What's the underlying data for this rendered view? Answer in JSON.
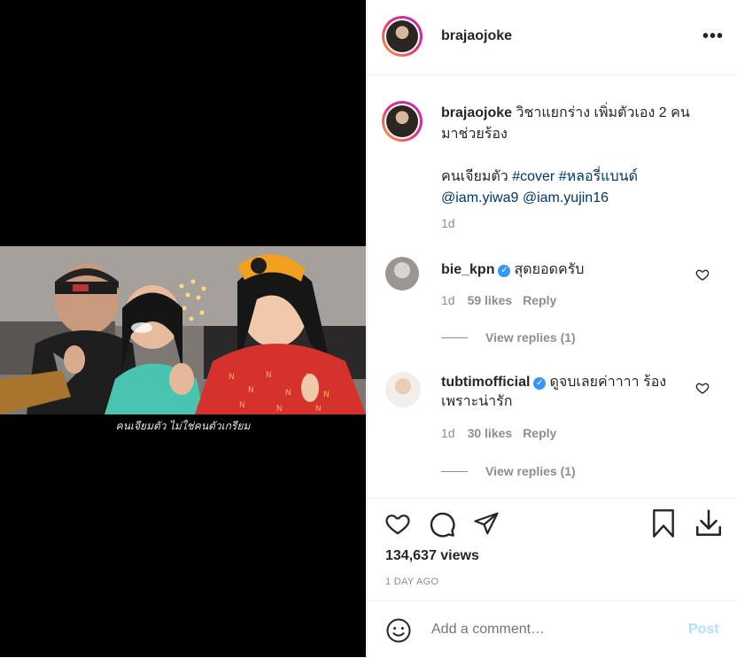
{
  "post_author": {
    "username": "brajaojoke"
  },
  "video": {
    "subtitle": "คนเจียมตัว ไม่ใช่คนตัวเกรียม"
  },
  "caption": {
    "username": "brajaojoke",
    "text_line1": "วิชาแยกร่าง เพิ่มตัวเอง 2 คน",
    "text_line2": "มาช่วยร้อง",
    "text_line3_plain": "คนเจียมตัว",
    "hashtag1": "#cover",
    "hashtag2": "#หลอรี่แบนด์",
    "mention1": "@iam.yiwa9",
    "mention2": "@iam.yujin16",
    "time": "1d"
  },
  "comments": [
    {
      "username": "bie_kpn",
      "verified": true,
      "text": "สุดยอดครับ",
      "time": "1d",
      "likes": "59 likes",
      "reply_label": "Reply",
      "view_replies": "View replies (1)"
    },
    {
      "username": "tubtimofficial",
      "verified": true,
      "text": "ดูจบเลยค่าาาา ร้อง",
      "text2": "เพราะน่ารัก",
      "time": "1d",
      "likes": "30 likes",
      "reply_label": "Reply",
      "view_replies": "View replies (1)"
    }
  ],
  "stats": {
    "views": "134,637 views",
    "ago": "1 DAY AGO"
  },
  "add_comment": {
    "placeholder": "Add a comment…",
    "post_label": "Post"
  },
  "colors": {
    "link": "#00376b",
    "verified": "#3897f0",
    "post_disabled": "#b2dffc"
  },
  "icons": [
    "more-icon",
    "heart-icon",
    "comment-icon",
    "share-icon",
    "bookmark-icon",
    "download-icon",
    "emoji-icon",
    "verified-icon"
  ]
}
